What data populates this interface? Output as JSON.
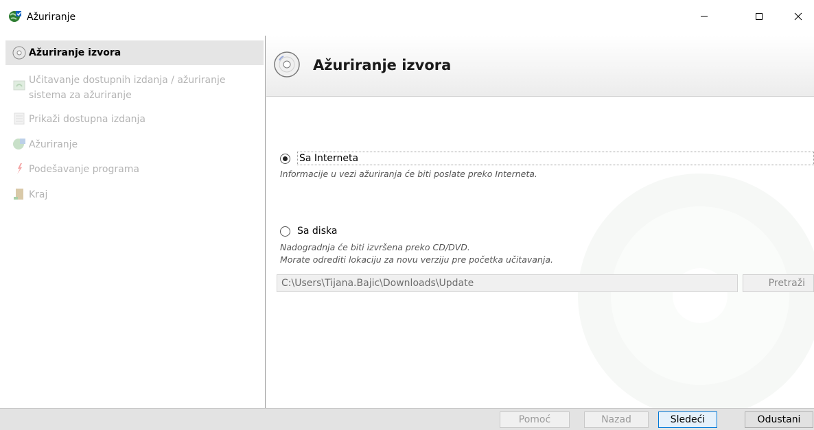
{
  "window": {
    "title": "Ažuriranje",
    "icon": "update-globe-icon",
    "controls": [
      "minimize-icon",
      "maximize-icon",
      "close-icon"
    ]
  },
  "sidebar": {
    "steps": [
      {
        "label": "Ažuriranje izvora",
        "icon": "disc-icon",
        "active": true
      },
      {
        "label": "Učitavanje dostupnih izdanja / ažuriranje",
        "label2": "sistema za ažuriranje",
        "icon": "download-icon",
        "active": false
      },
      {
        "label": "Prikaži dostupna izdanja",
        "icon": "list-icon",
        "active": false
      },
      {
        "label": "Ažuriranje",
        "icon": "update-globe-icon",
        "active": false
      },
      {
        "label": "Podešavanje programa",
        "icon": "settings-pen-icon",
        "active": false
      },
      {
        "label": "Kraj",
        "icon": "exit-door-icon",
        "active": false
      }
    ]
  },
  "header": {
    "title": "Ažuriranje izvora"
  },
  "options": {
    "internet": {
      "label": "Sa Interneta",
      "checked": true,
      "description": "Informacije u vezi ažuriranja će biti poslate preko Interneta."
    },
    "disk": {
      "label": "Sa diska",
      "checked": false,
      "description1": "Nadogradnja će biti izvršena preko CD/DVD.",
      "description2": "Morate odrediti lokaciju za novu verziju pre početka učitavanja.",
      "path_value": "C:\\Users\\Tijana.Bajic\\Downloads\\Update",
      "browse_label": "Pretraži"
    }
  },
  "footer": {
    "help_label": "Pomoć",
    "back_label": "Nazad",
    "next_label": "Sledeći",
    "cancel_label": "Odustani"
  },
  "colors": {
    "active_step_bg": "#e5e5e5",
    "disabled_text": "#b4b4b4",
    "focus_border": "#0078d7"
  }
}
